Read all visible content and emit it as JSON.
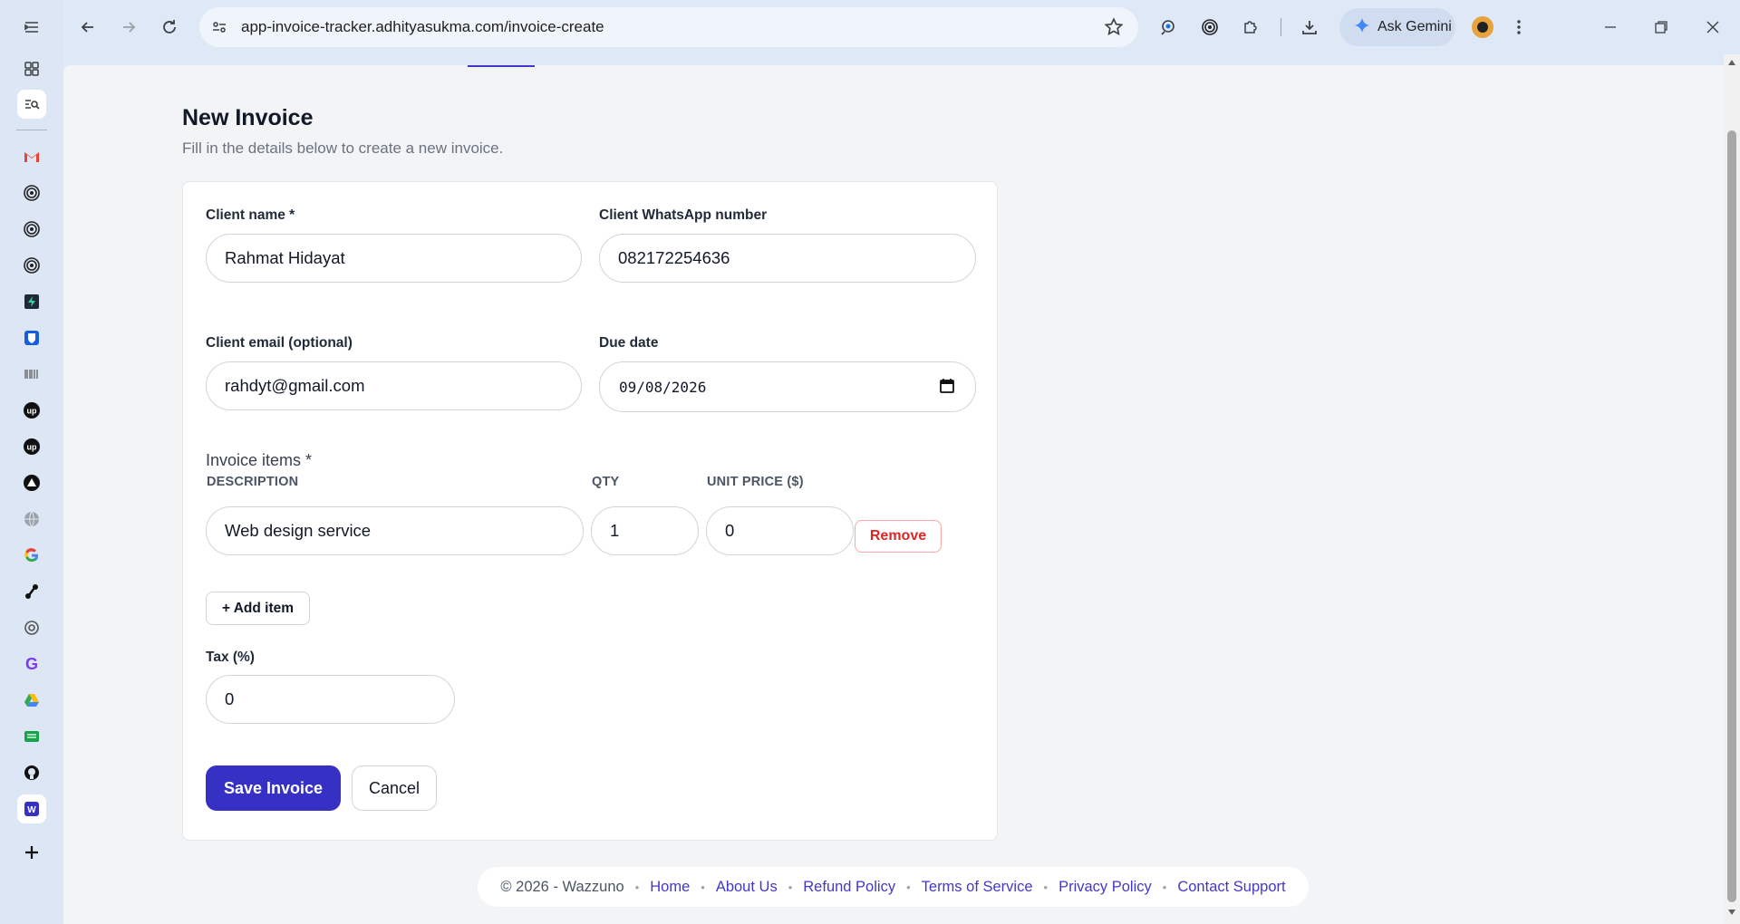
{
  "browser": {
    "url": "app-invoice-tracker.adhityasukma.com/invoice-create",
    "gemini_label": "Ask Gemini"
  },
  "sidebar": {
    "icons": [
      "tab-groups-icon",
      "tab-search-icon",
      "gmail-icon",
      "target-icon",
      "target-icon",
      "target-icon",
      "bolt-app-icon",
      "bitwarden-icon",
      "barcode-icon",
      "upwork-icon",
      "upwork-icon",
      "triangle-app-icon",
      "globe-icon",
      "google-icon",
      "link-app-icon",
      "openai-icon",
      "grammarly-icon",
      "google-drive-icon",
      "sheets-icon",
      "github-icon",
      "wazzuno-icon",
      "new-tab-plus-icon"
    ]
  },
  "page": {
    "title": "New Invoice",
    "subtitle": "Fill in the details below to create a new invoice."
  },
  "form": {
    "client_name_label": "Client name *",
    "client_name_value": "Rahmat Hidayat",
    "whatsapp_label": "Client WhatsApp number",
    "whatsapp_value": "082172254636",
    "email_label": "Client email (optional)",
    "email_value": "rahdyt@gmail.com",
    "due_date_label": "Due date",
    "due_date_value": "09/08/2026",
    "items_label": "Invoice items *",
    "columns": {
      "description": "DESCRIPTION",
      "qty": "QTY",
      "unit_price": "UNIT PRICE ($)"
    },
    "items": [
      {
        "description": "Web design service",
        "qty": "1",
        "unit_price": "0",
        "remove_label": "Remove"
      }
    ],
    "add_item_label": "+ Add item",
    "tax_label": "Tax (%)",
    "tax_value": "0",
    "save_label": "Save Invoice",
    "cancel_label": "Cancel"
  },
  "footer": {
    "copyright": "© 2026 - Wazzuno",
    "links": [
      "Home",
      "About Us",
      "Refund Policy",
      "Terms of Service",
      "Privacy Policy",
      "Contact Support"
    ]
  },
  "colors": {
    "accent": "#3730c4",
    "danger": "#dc2626",
    "link": "#4338ca"
  }
}
